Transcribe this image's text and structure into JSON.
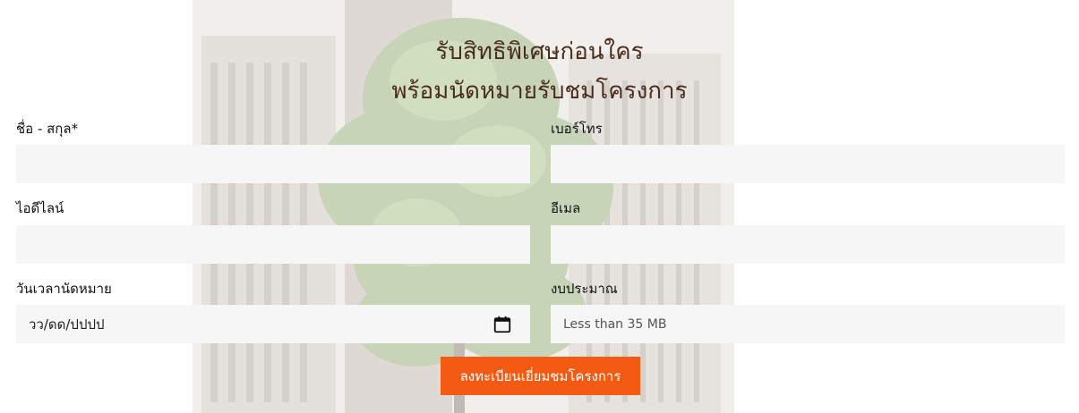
{
  "form": {
    "heading_line1": "รับสิทธิพิเศษก่อนใคร",
    "heading_line2": "พร้อมนัดหมายรับชมโครงการ",
    "fields": {
      "name": {
        "label": "ชื่อ - สกุล*",
        "value": ""
      },
      "phone": {
        "label": "เบอร์โทร",
        "value": ""
      },
      "line_id": {
        "label": "ไอดีไลน์",
        "value": ""
      },
      "email": {
        "label": "อีเมล",
        "value": ""
      },
      "appointment": {
        "label": "วันเวลานัดหมาย",
        "placeholder": "วว/ดด/ปปปป",
        "icon": "calendar-icon"
      },
      "budget": {
        "label": "งบประมาณ",
        "value": "Less than 35 MB"
      }
    },
    "submit_label": "ลงทะเบียนเยี่ยมชมโครงการ"
  },
  "colors": {
    "heading": "#4a2c1d",
    "accent": "#f45b12",
    "input_bg": "#f6f6f6"
  }
}
